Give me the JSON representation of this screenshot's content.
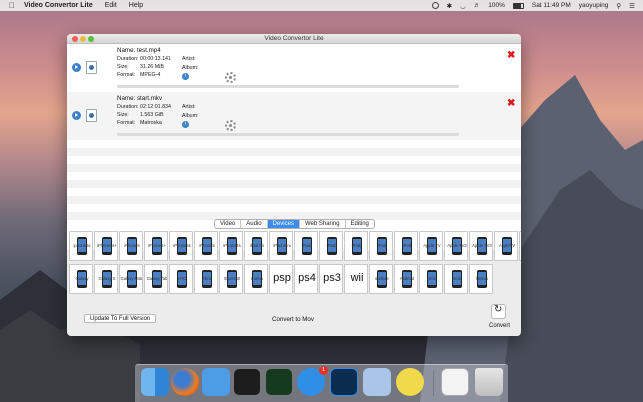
{
  "menubar": {
    "app_name": "Video Convertor Lite",
    "menus": [
      "Edit",
      "Help"
    ],
    "battery": "100%",
    "clock": "Sat 11:49 PM",
    "user": "yaoyuping"
  },
  "window": {
    "title": "Video Convertor Lite"
  },
  "files": [
    {
      "name": "Name: test.mp4",
      "duration_label": "Duration:",
      "duration": "00:00:13.141",
      "size_label": "Size:",
      "size": "31.26 MiB",
      "format_label": "Format:",
      "format": "MPEG-4",
      "artist_label": "Artist:",
      "album_label": "Album:"
    },
    {
      "name": "Name: start.mkv",
      "duration_label": "Duration:",
      "duration": "02:12:01.834",
      "size_label": "Size:",
      "size": "1.563 GiB",
      "format_label": "Format:",
      "format": "Matroska",
      "artist_label": "Artist:",
      "album_label": "Album:"
    }
  ],
  "tabs": [
    "Video",
    "Audio",
    "Devices",
    "Web Sharing",
    "Editing"
  ],
  "active_tab": "Devices",
  "devices_row1": [
    "iphone6s",
    "iPhone6s+",
    "iPhone6",
    "iPhone6+",
    "iPhone5s",
    "iPhone5",
    "iPhone4s",
    "iPad Air",
    "iPad mini",
    "iPad4",
    "iPad3",
    "iPad2",
    "iPad",
    "iPod",
    "Apple TV",
    "Apple TV2",
    "Apple TV3",
    "AppleTV",
    "Android"
  ],
  "devices_row2": [
    "Galaxy",
    "Galaxy S",
    "Galaxy Note",
    "Galaxy Tab",
    "HTC",
    "Xbox",
    "Xbox360",
    "Lumia",
    "psp",
    "ps4",
    "ps3",
    "wii",
    "surface",
    "Android",
    "Droid",
    "Droid",
    "Nexus"
  ],
  "buttons": {
    "update": "Update To Full Version",
    "convert_to": "Convert to Mov",
    "convert": "Convert"
  },
  "dock": {
    "app_store_badge": "1"
  },
  "colors": {
    "accent": "#3d8bed",
    "remove": "#e0191c"
  }
}
